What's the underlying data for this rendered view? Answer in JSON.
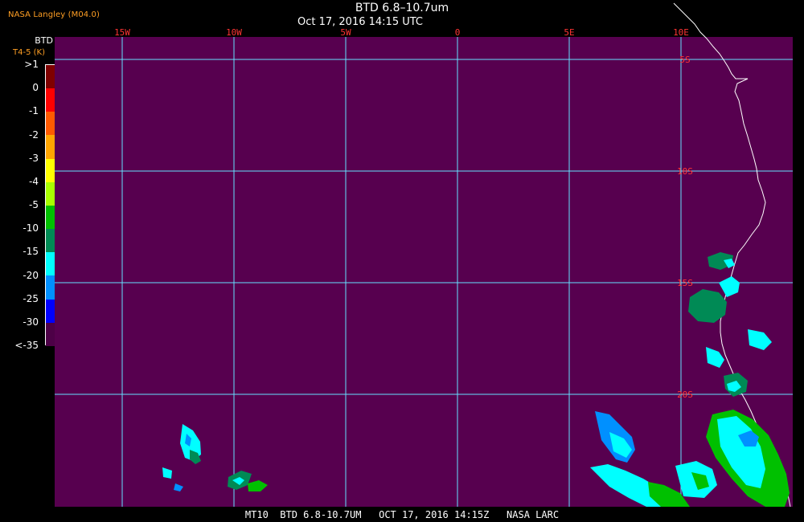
{
  "header": {
    "org": "NASA Langley (M04.0)",
    "title": "BTD 6.8–10.7um",
    "timestamp": "Oct 17, 2016 14:15 UTC"
  },
  "legend": {
    "title": "BTD",
    "subtitle": "T4-5 (K)",
    "labels": [
      ">1",
      "0",
      "-1",
      "-2",
      "-3",
      "-4",
      "-5",
      "-10",
      "-15",
      "-20",
      "-25",
      "-30",
      "<-35"
    ],
    "colors": [
      "#7f0000",
      "#ff0000",
      "#ff5a00",
      "#ffa500",
      "#ffff00",
      "#a8ff00",
      "#00c000",
      "#008a55",
      "#00ffff",
      "#0090ff",
      "#0000ff",
      "#4d0047"
    ]
  },
  "map": {
    "longitude_labels": [
      "15W",
      "10W",
      "5W",
      "0",
      "5E",
      "10E"
    ],
    "latitude_labels": [
      "5S",
      "10S",
      "15S",
      "20S"
    ],
    "grid_color": "#66e2ff",
    "background_color": "#57004f"
  },
  "footer": {
    "text": "MT10  BTD 6.8-10.7UM   OCT 17, 2016 14:15Z   NASA LARC"
  }
}
